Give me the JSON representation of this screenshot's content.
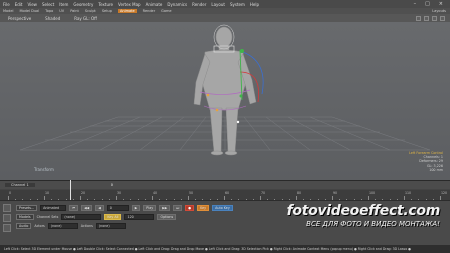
{
  "menu": [
    "File",
    "Edit",
    "View",
    "Select",
    "Item",
    "Geometry",
    "Texture",
    "Vertex Map",
    "Animate",
    "Dynamics",
    "Render",
    "Layout",
    "System",
    "Help"
  ],
  "toolbar": {
    "items": [
      "Model",
      "Model Dual",
      "Topo",
      "UV",
      "Paint",
      "Sculpt",
      "Setup",
      "Animate",
      "Render",
      "Game"
    ],
    "active": "Animate",
    "right": "Layouts"
  },
  "viewport_header": {
    "view": "Perspective",
    "shading": "Shaded",
    "ray": "Ray GL: Off"
  },
  "viewport": {
    "item_label": "Transform",
    "info_title": "Left Forearm Control",
    "info_lines": [
      "Channels: 1",
      "Deformers: 29",
      "GL: 3,226",
      "100 mm"
    ]
  },
  "timeline": {
    "channel": "Channel 1",
    "current": "0",
    "ticks": [
      "0",
      "2",
      "4",
      "6",
      "8",
      "10",
      "12",
      "14",
      "16",
      "18",
      "20",
      "22",
      "24",
      "26",
      "28",
      "30",
      "32",
      "34",
      "36",
      "38",
      "40",
      "42",
      "44",
      "46",
      "48",
      "50",
      "52",
      "54",
      "56",
      "58",
      "60",
      "62",
      "64",
      "66",
      "68",
      "70",
      "72",
      "74",
      "76",
      "78",
      "80",
      "82",
      "84",
      "86",
      "88",
      "90",
      "92",
      "94",
      "96",
      "98",
      "100",
      "102",
      "104",
      "106",
      "108",
      "110",
      "112",
      "114",
      "116",
      "118",
      "120"
    ]
  },
  "bottom": {
    "left_tabs": [
      "Presets...",
      "Models",
      "Audio"
    ],
    "animated_label": "Animated",
    "key_label": "Key",
    "channel_sets": "Channel Sets",
    "key_all": "Key All",
    "auto_key": "Auto Key",
    "actors": "Actors",
    "actions": "Actions",
    "none": "(none)",
    "frame_value": "0",
    "play_label": "Play",
    "end_frame": "120",
    "options": "Options"
  },
  "watermark": {
    "title": "fotovideoeffect.com",
    "subtitle": "ВСЕ ДЛЯ ФОТО И ВИДЕО МОНТАЖА!"
  },
  "status": "Left Click: Select 3D Element under Mouse ● Left Double Click: Select Connected ● Left Click and Drag: Drag and Drop Move ● Left Click and Drag: 3D Selection Pick ● Right Click: Animate Context Menu (popup menu) ● Right Click and Drag: 3D Lasso ●"
}
